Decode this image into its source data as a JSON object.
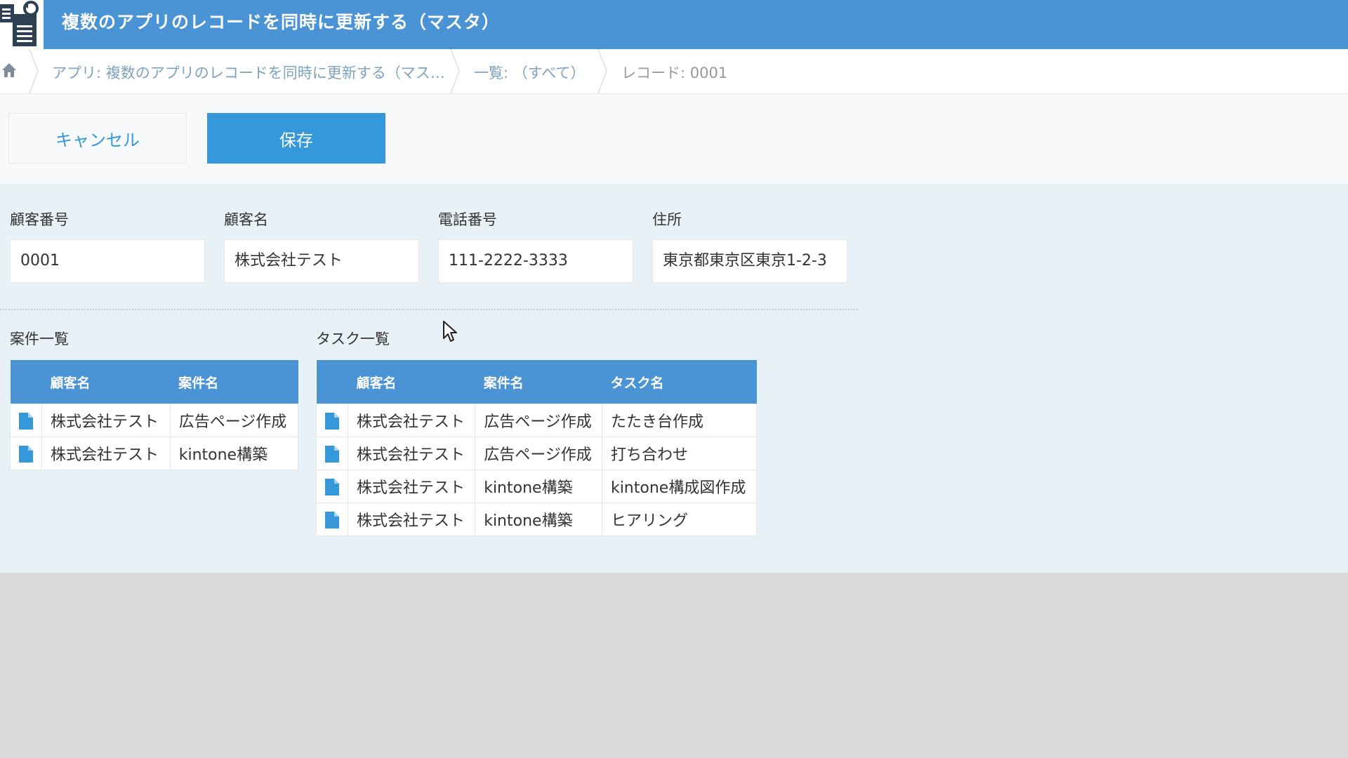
{
  "app": {
    "title": "複数のアプリのレコードを同時に更新する（マスタ）"
  },
  "breadcrumb": {
    "app": "アプリ: 複数のアプリのレコードを同時に更新する（マス…",
    "view": "一覧: （すべて）",
    "record": "レコード: 0001"
  },
  "toolbar": {
    "cancel_label": "キャンセル",
    "save_label": "保存"
  },
  "fields": {
    "customer_no": {
      "label": "顧客番号",
      "value": "0001"
    },
    "customer_name": {
      "label": "顧客名",
      "value": "株式会社テスト"
    },
    "phone": {
      "label": "電話番号",
      "value": "111-2222-3333"
    },
    "address": {
      "label": "住所",
      "value": "東京都東京区東京1-2-3"
    }
  },
  "projects": {
    "title": "案件一覧",
    "headers": [
      "顧客名",
      "案件名"
    ],
    "rows": [
      [
        "株式会社テスト",
        "広告ページ作成"
      ],
      [
        "株式会社テスト",
        "kintone構築"
      ]
    ]
  },
  "tasks": {
    "title": "タスク一覧",
    "headers": [
      "顧客名",
      "案件名",
      "タスク名"
    ],
    "rows": [
      [
        "株式会社テスト",
        "広告ページ作成",
        "たたき台作成"
      ],
      [
        "株式会社テスト",
        "広告ページ作成",
        "打ち合わせ"
      ],
      [
        "株式会社テスト",
        "kintone構築",
        "kintone構成図作成"
      ],
      [
        "株式会社テスト",
        "kintone構築",
        "ヒアリング"
      ]
    ]
  },
  "colors": {
    "header": "#4a93d4",
    "accent": "#3498db",
    "content_bg": "#e8f1f5"
  },
  "icons": [
    "app-icon",
    "home-icon",
    "record-doc-icon",
    "mouse-cursor-icon"
  ]
}
